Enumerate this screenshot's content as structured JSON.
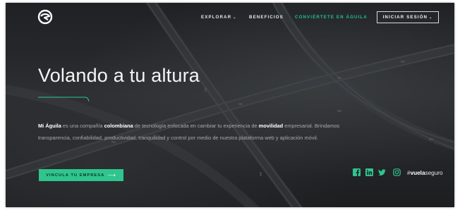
{
  "nav": {
    "links": [
      {
        "label": "EXPLORAR",
        "chevron": "⌄"
      },
      {
        "label": "BENEFICIOS"
      },
      {
        "label": "CONVIÉRTETE EN ÁGUILA"
      }
    ],
    "login": {
      "label": "INICIAR SESIÓN",
      "chevron": "⌄"
    },
    "cta_color": "#22c18a"
  },
  "hero": {
    "title": "Volando a tu altura",
    "description": {
      "p1": "Mi Águila",
      "p2": " es una compañía ",
      "p3": "colombiana",
      "p4": " de tecnología enfocada en cambiar tu experiencia de ",
      "p5": "movilidad",
      "p6": " empresarial. Brindamos transparencia, confiabilidad, productividad, tranquilidad y control por medio de nuestra plataforma web y aplicación móvil."
    },
    "cta": {
      "label": "VINCULA TU EMPRESA",
      "arrow": "⟶"
    },
    "accent_color": "#2fc58e"
  },
  "social": {
    "icons": [
      "facebook-icon",
      "linkedin-icon",
      "twitter-icon",
      "instagram-icon"
    ],
    "hashtag_prefix": "#",
    "hashtag_bold": "vuela",
    "hashtag_rest": "seguro"
  }
}
